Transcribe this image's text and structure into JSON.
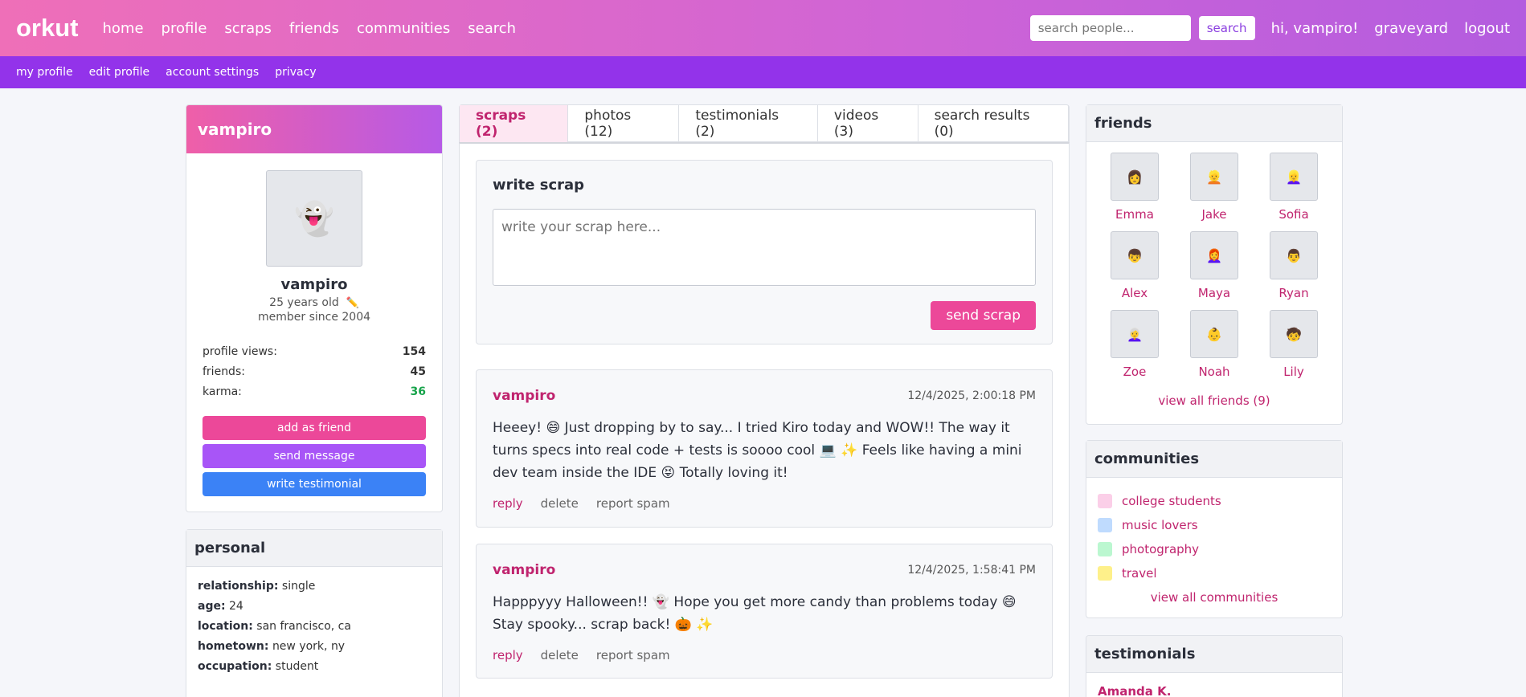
{
  "header": {
    "logo": "orkut",
    "nav": [
      "home",
      "profile",
      "scraps",
      "friends",
      "communities",
      "search"
    ],
    "search_placeholder": "search people...",
    "search_button": "search",
    "greeting": "hi, vampiro!",
    "graveyard": "graveyard",
    "logout": "logout"
  },
  "subnav": [
    "my profile",
    "edit profile",
    "account settings",
    "privacy"
  ],
  "profile": {
    "header_name": "vampiro",
    "avatar": "👻",
    "name": "vampiro",
    "age": "25 years old",
    "edit_icon": "✏️",
    "member_since": "member since 2004",
    "stats": [
      {
        "label": "profile views:",
        "value": "154"
      },
      {
        "label": "friends:",
        "value": "45"
      },
      {
        "label": "karma:",
        "value": "36"
      }
    ],
    "buttons": {
      "add_friend": "add as friend",
      "send_message": "send message",
      "write_testimonial": "write testimonial"
    }
  },
  "personal": {
    "title": "personal",
    "fields": [
      {
        "label": "relationship:",
        "value": "single"
      },
      {
        "label": "age:",
        "value": "24"
      },
      {
        "label": "location:",
        "value": "san francisco, ca"
      },
      {
        "label": "hometown:",
        "value": "new york, ny"
      },
      {
        "label": "occupation:",
        "value": "student"
      }
    ]
  },
  "tabs": [
    "scraps (2)",
    "photos (12)",
    "testimonials (2)",
    "videos (3)",
    "search results (0)"
  ],
  "write_scrap": {
    "title": "write scrap",
    "placeholder": "write your scrap here...",
    "send": "send scrap"
  },
  "scraps": [
    {
      "author": "vampiro",
      "time": "12/4/2025, 2:00:18 PM",
      "body": "Heeey! 😄 Just dropping by to say... I tried Kiro today and WOW!! The way it turns specs into real code + tests is soooo cool 💻 ✨ Feels like having a mini dev team inside the IDE 😝 Totally loving it!",
      "actions": [
        "reply",
        "delete",
        "report spam"
      ]
    },
    {
      "author": "vampiro",
      "time": "12/4/2025, 1:58:41 PM",
      "body": "Happpyyy Halloween!! 👻 Hope you get more candy than problems today 😄 Stay spooky... scrap back! 🎃 ✨",
      "actions": [
        "reply",
        "delete",
        "report spam"
      ]
    }
  ],
  "friends": {
    "title": "friends",
    "items": [
      {
        "name": "Emma",
        "avatar": "👩"
      },
      {
        "name": "Jake",
        "avatar": "👱"
      },
      {
        "name": "Sofia",
        "avatar": "👱‍♀️"
      },
      {
        "name": "Alex",
        "avatar": "👦"
      },
      {
        "name": "Maya",
        "avatar": "👩‍🦰"
      },
      {
        "name": "Ryan",
        "avatar": "👨"
      },
      {
        "name": "Zoe",
        "avatar": "👩‍🦳"
      },
      {
        "name": "Noah",
        "avatar": "👶"
      },
      {
        "name": "Lily",
        "avatar": "🧒"
      }
    ],
    "view_all": "view all friends (9)"
  },
  "communities": {
    "title": "communities",
    "items": [
      {
        "name": "college students",
        "color": "#fbcfe8"
      },
      {
        "name": "music lovers",
        "color": "#bfdbfe"
      },
      {
        "name": "photography",
        "color": "#bbf7d0"
      },
      {
        "name": "travel",
        "color": "#fef08a"
      }
    ],
    "view_all": "view all communities"
  },
  "testimonials": {
    "title": "testimonials",
    "first_author": "Amanda K."
  }
}
